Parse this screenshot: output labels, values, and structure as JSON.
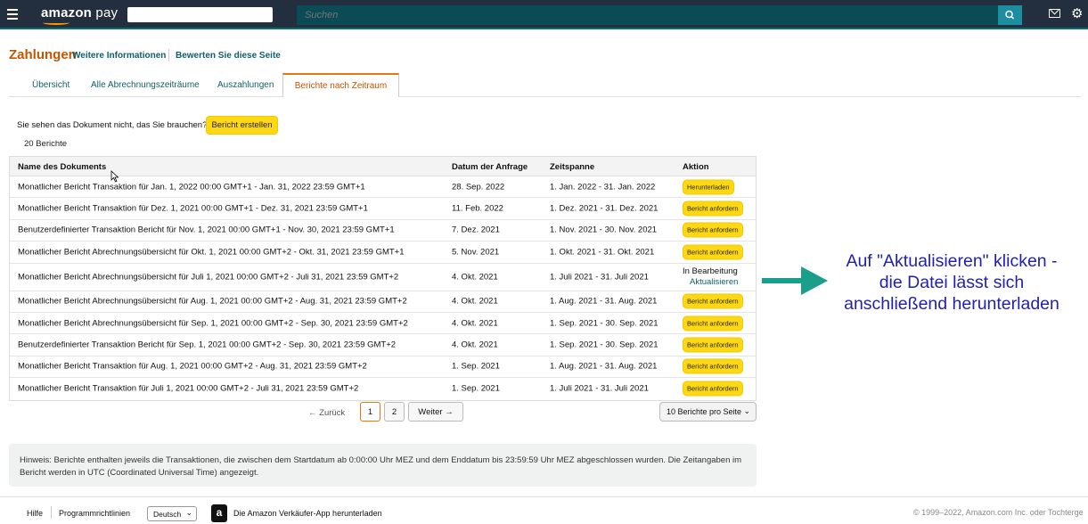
{
  "topbar": {
    "logo_amazon": "amazon",
    "logo_pay": " pay",
    "search_placeholder": "Suchen"
  },
  "header": {
    "title": "Zahlungen",
    "more_info": "Weitere Informationen",
    "rate_page": "Bewerten Sie diese Seite"
  },
  "tabs": [
    {
      "label": "Übersicht"
    },
    {
      "label": "Alle Abrechnungszeiträume"
    },
    {
      "label": "Auszahlungen"
    },
    {
      "label": "Berichte nach Zeitraum",
      "active": true
    }
  ],
  "report_prompt": "Sie sehen das Dokument nicht, das Sie brauchen?",
  "create_report_label": "Bericht erstellen",
  "report_count": "20 Berichte",
  "table": {
    "headers": [
      "Name des Dokuments",
      "Datum der Anfrage",
      "Zeitspanne",
      "Aktion"
    ],
    "rows": [
      {
        "name": "Monatlicher Bericht Transaktion für Jan. 1, 2022 00:00 GMT+1 - Jan. 31, 2022 23:59 GMT+1",
        "date": "28. Sep. 2022",
        "span": "1. Jan. 2022 - 31. Jan. 2022",
        "action": "Herunterladen"
      },
      {
        "name": "Monatlicher Bericht Transaktion für Dez. 1, 2021 00:00 GMT+1 - Dez. 31, 2021 23:59 GMT+1",
        "date": "11. Feb. 2022",
        "span": "1. Dez. 2021 - 31. Dez. 2021",
        "action": "Bericht anfordern"
      },
      {
        "name": "Benutzerdefinierter Transaktion Bericht für Nov. 1, 2021 00:00 GMT+1 - Nov. 30, 2021 23:59 GMT+1",
        "date": "7. Dez. 2021",
        "span": "1. Nov. 2021 - 30. Nov. 2021",
        "action": "Bericht anfordern"
      },
      {
        "name": "Monatlicher Bericht Abrechnungsübersicht für Okt. 1, 2021 00:00 GMT+2 - Okt. 31, 2021 23:59 GMT+1",
        "date": "5. Nov. 2021",
        "span": "1. Okt. 2021 - 31. Okt. 2021",
        "action": "Bericht anfordern"
      },
      {
        "name": "Monatlicher Bericht Abrechnungsübersicht für Juli 1, 2021 00:00 GMT+2 - Juli 31, 2021 23:59 GMT+2",
        "date": "4. Okt. 2021",
        "span": "1. Juli 2021 - 31. Juli 2021",
        "status": "In Bearbeitung",
        "status_link": "Aktualisieren"
      },
      {
        "name": "Monatlicher Bericht Abrechnungsübersicht für Aug. 1, 2021 00:00 GMT+2 - Aug. 31, 2021 23:59 GMT+2",
        "date": "4. Okt. 2021",
        "span": "1. Aug. 2021 - 31. Aug. 2021",
        "action": "Bericht anfordern"
      },
      {
        "name": "Monatlicher Bericht Abrechnungsübersicht für Sep. 1, 2021 00:00 GMT+2 - Sep. 30, 2021 23:59 GMT+2",
        "date": "4. Okt. 2021",
        "span": "1. Sep. 2021 - 30. Sep. 2021",
        "action": "Bericht anfordern"
      },
      {
        "name": "Benutzerdefinierter Transaktion Bericht für Sep. 1, 2021 00:00 GMT+2 - Sep. 30, 2021 23:59 GMT+2",
        "date": "4. Okt. 2021",
        "span": "1. Sep. 2021 - 30. Sep. 2021",
        "action": "Bericht anfordern"
      },
      {
        "name": "Monatlicher Bericht Transaktion für Aug. 1, 2021 00:00 GMT+2 - Aug. 31, 2021 23:59 GMT+2",
        "date": "1. Sep. 2021",
        "span": "1. Aug. 2021 - 31. Aug. 2021",
        "action": "Bericht anfordern"
      },
      {
        "name": "Monatlicher Bericht Transaktion für Juli 1, 2021 00:00 GMT+2 - Juli 31, 2021 23:59 GMT+2",
        "date": "1. Sep. 2021",
        "span": "1. Juli 2021 - 31. Juli 2021",
        "action": "Bericht anfordern"
      }
    ]
  },
  "pagination": {
    "prev": "← Zurück",
    "pages": [
      "1",
      "2"
    ],
    "current": "1",
    "next": "Weiter →",
    "per_page": "10 Berichte pro Seite"
  },
  "annotation": {
    "line1": "Auf \"Aktualisieren\" klicken -",
    "line2": "die Datei lässt sich",
    "line3": "anschließend herunterladen",
    "arrow_color": "#1aa08a"
  },
  "note": "Hinweis: Berichte enthalten jeweils die Transaktionen, die zwischen dem Startdatum ab 0:00:00 Uhr MEZ und dem Enddatum bis 23:59:59 Uhr MEZ abgeschlossen wurden. Die Zeitangaben im Bericht werden in UTC (Coordinated Universal Time) angezeigt.",
  "footer": {
    "help": "Hilfe",
    "policies": "Programmrichtlinien",
    "language": "Deutsch",
    "app_download": "Die Amazon Verkäufer-App herunterladen",
    "copyright": "© 1999–2022, Amazon.com Inc. oder Tochterge"
  },
  "colors": {
    "topbar": "#232f3e",
    "accent_orange": "#c45500",
    "button_yellow": "#ffd814",
    "link_teal": "#0f5f6a",
    "annotation_blue": "#1f1fb0"
  }
}
